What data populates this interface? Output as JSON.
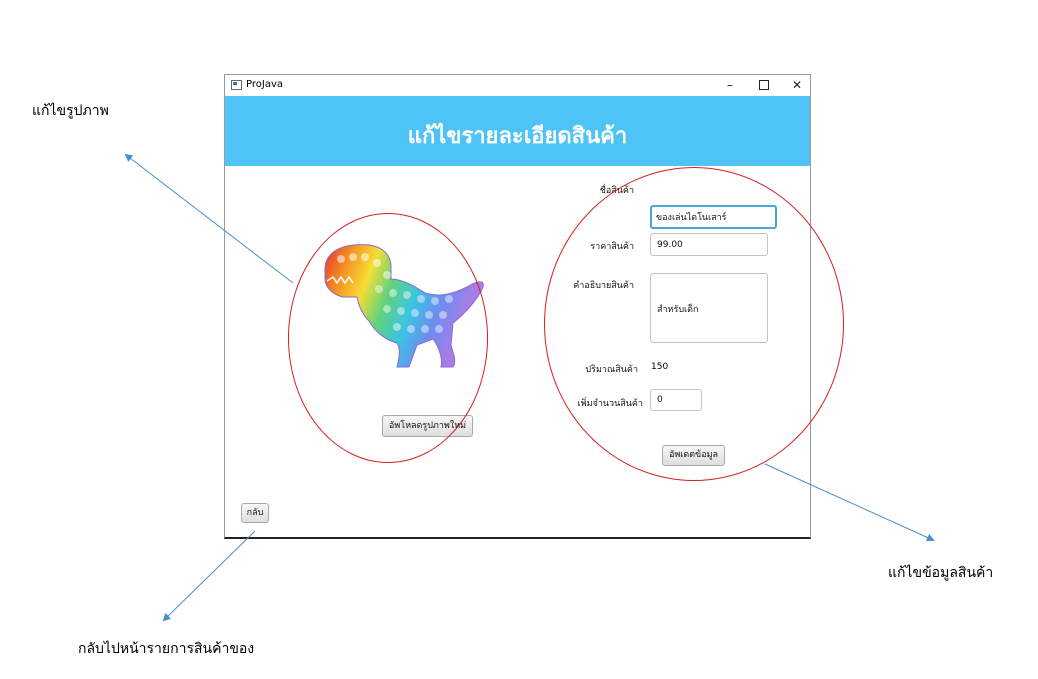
{
  "annotations": {
    "edit_image": "แก้ไขรูปภาพ",
    "edit_info": "แก้ไขข้อมูลสินค้า",
    "back": "กลับไปหน้ารายการสินค้าของ"
  },
  "window": {
    "title": "ProJava",
    "minimize": "–",
    "close": "✕"
  },
  "header": {
    "title": "แก้ไขรายละเอียดสินค้า"
  },
  "image": {
    "description_icon": "dinosaur-popit-icon",
    "upload_label": "อัพโหลดรูปภาพใหม่"
  },
  "form": {
    "name_label": "ชื่อสินค้า",
    "name_value": "ของเล่นไดโนเสาร์",
    "price_label": "ราคาสินค้า",
    "price_value": "99.00",
    "desc_label": "คำอธิบายสินค้า",
    "desc_value": "สำหรับเด็ก",
    "qty_label": "ปริมาณสินค้า",
    "qty_value": "150",
    "add_label": "เพิ่มจำนวนสินค้า",
    "add_value": "0",
    "update_label": "อัพเดตข้อมูล"
  },
  "back_label": "กลับ",
  "colors": {
    "header": "#4ec3f5",
    "annotation_circle": "#d62020",
    "annotation_arrow": "#4a90c8",
    "focus": "#46a7d8"
  }
}
